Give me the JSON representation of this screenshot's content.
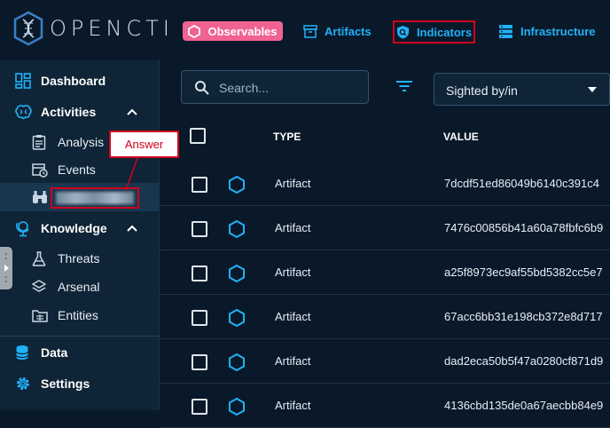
{
  "app": {
    "logo_text": "OPENCTI"
  },
  "topnav": [
    {
      "label": "Observables",
      "icon": "hexagon-icon"
    },
    {
      "label": "Artifacts",
      "icon": "archive-icon"
    },
    {
      "label": "Indicators",
      "icon": "shield-search-icon"
    },
    {
      "label": "Infrastructure",
      "icon": "server-icon"
    }
  ],
  "sidebar": {
    "dashboard": "Dashboard",
    "activities": "Activities",
    "analysis": "Analysis",
    "events": "Events",
    "knowledge": "Knowledge",
    "threats": "Threats",
    "arsenal": "Arsenal",
    "entities": "Entities",
    "data": "Data",
    "settings": "Settings"
  },
  "annotation": {
    "answer": "Answer"
  },
  "toolbar": {
    "search_placeholder": "Search...",
    "sort_value": "Sighted by/in"
  },
  "table": {
    "headers": {
      "type": "TYPE",
      "value": "VALUE"
    },
    "rows": [
      {
        "type": "Artifact",
        "value": "7dcdf51ed86049b6140c391c4"
      },
      {
        "type": "Artifact",
        "value": "7476c00856b41a60a78fbfc6b9"
      },
      {
        "type": "Artifact",
        "value": "a25f8973ec9af55bd5382cc5e7"
      },
      {
        "type": "Artifact",
        "value": "67acc6bb31e198cb372e8d717"
      },
      {
        "type": "Artifact",
        "value": "dad2eca50b5f47a0280cf871d9"
      },
      {
        "type": "Artifact",
        "value": "4136cbd135de0a67aecbb84e9"
      }
    ]
  },
  "colors": {
    "accent": "#20b2f8",
    "observables_bg": "#f06292",
    "annotation_red": "#d0021b",
    "background": "#0a1929",
    "sidebar_bg": "#0f2436"
  }
}
